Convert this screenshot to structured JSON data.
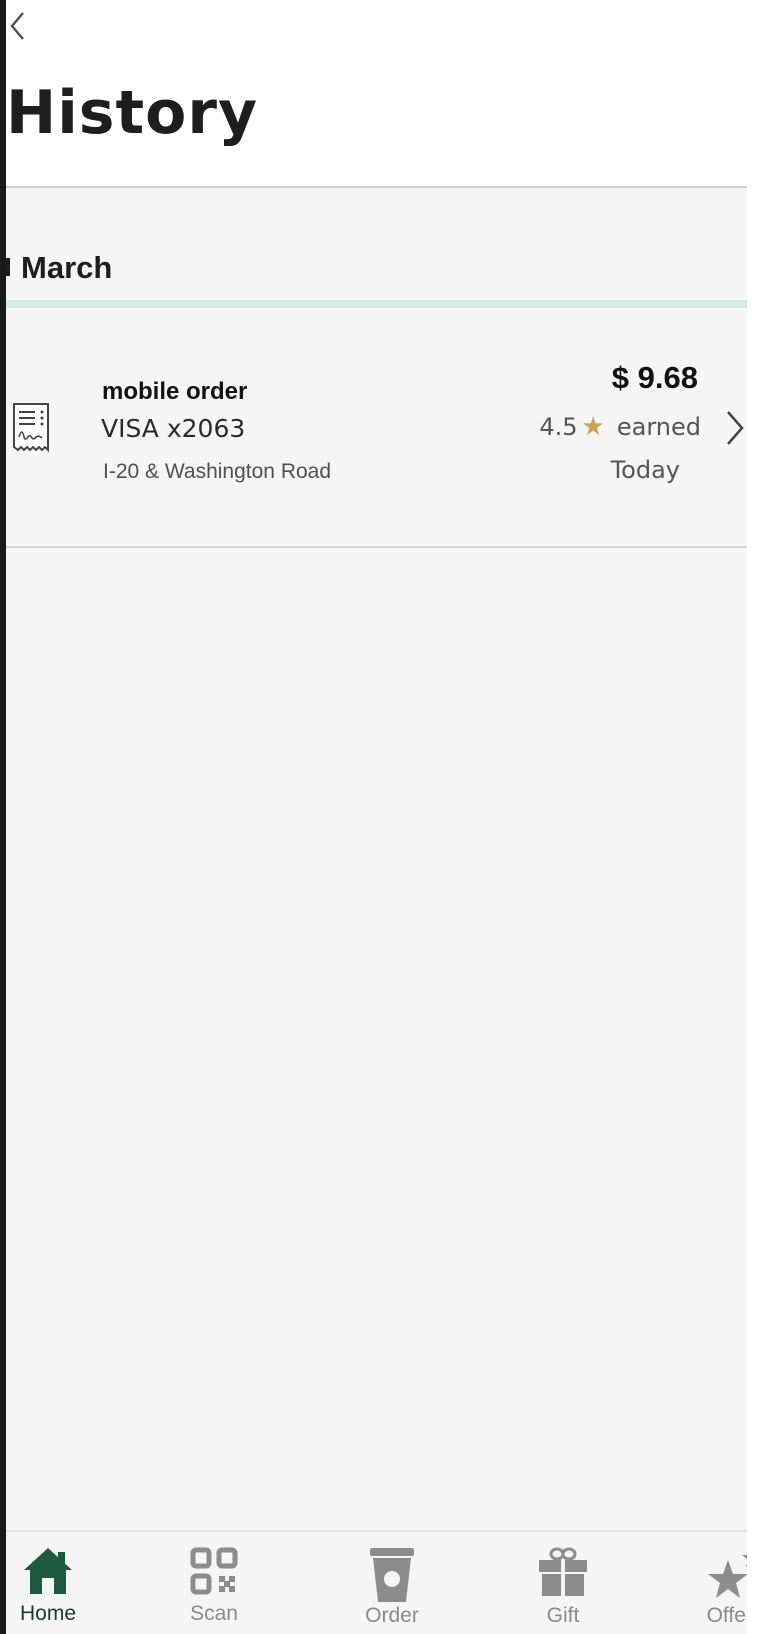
{
  "header": {
    "title": "History",
    "back_icon": "back-chevron-icon"
  },
  "section": {
    "title": "March"
  },
  "transactions": [
    {
      "title": "mobile order",
      "payment": "VISA x2063",
      "location": "I-20 & Washington Road",
      "amount": "$ 9.68",
      "stars_value": "4.5",
      "stars_suffix": "earned",
      "date": "Today",
      "icon": "receipt-icon"
    }
  ],
  "tabbar": {
    "items": [
      {
        "label": "Home",
        "icon": "home-icon",
        "active": true
      },
      {
        "label": "Scan",
        "icon": "qr-code-icon",
        "active": false
      },
      {
        "label": "Order",
        "icon": "cup-icon",
        "active": false
      },
      {
        "label": "Gift",
        "icon": "gift-icon",
        "active": false
      },
      {
        "label": "Offers",
        "icon": "stars-icon",
        "active": false
      }
    ]
  },
  "colors": {
    "accent_green": "#1e3932",
    "star_gold": "#cba258",
    "section_line": "#d4e9e2",
    "inactive_tab": "#8a8a8a"
  }
}
